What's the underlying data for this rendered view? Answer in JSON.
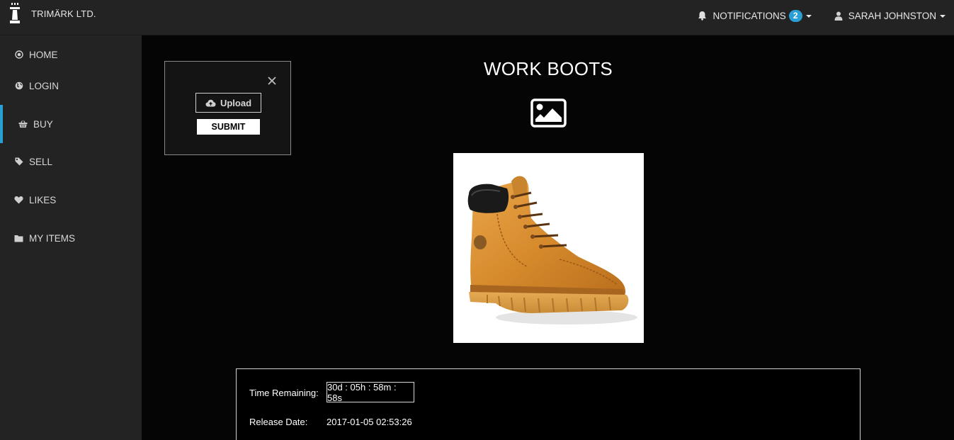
{
  "brand": {
    "name": "TRIMÄRK LTD.",
    "logo_icon": "lighthouse-logo-icon"
  },
  "header": {
    "notifications": {
      "label": "NOTIFICATIONS",
      "count": "2",
      "icon": "bell-icon"
    },
    "user": {
      "name": "SARAH JOHNSTON",
      "icon": "user-icon"
    }
  },
  "sidebar": {
    "items": [
      {
        "label": "HOME",
        "icon": "target-icon"
      },
      {
        "label": "LOGIN",
        "icon": "globe-icon"
      },
      {
        "label": "BUY",
        "icon": "basket-icon",
        "active": true
      },
      {
        "label": "SELL",
        "icon": "tag-icon"
      },
      {
        "label": "LIKES",
        "icon": "heart-icon"
      },
      {
        "label": "MY ITEMS",
        "icon": "folder-icon"
      }
    ]
  },
  "upload_panel": {
    "upload_label": "Upload",
    "submit_label": "SUBMIT"
  },
  "product": {
    "title": "WORK BOOTS"
  },
  "details": {
    "time_remaining_label": "Time Remaining:",
    "time_remaining_value": "30d : 05h : 58m : 58s",
    "release_date_label": "Release Date:",
    "release_date_value": "2017-01-05 02:53:26"
  },
  "colors": {
    "accent": "#2a9fd6",
    "navbar": "#232323",
    "background": "#050505"
  }
}
